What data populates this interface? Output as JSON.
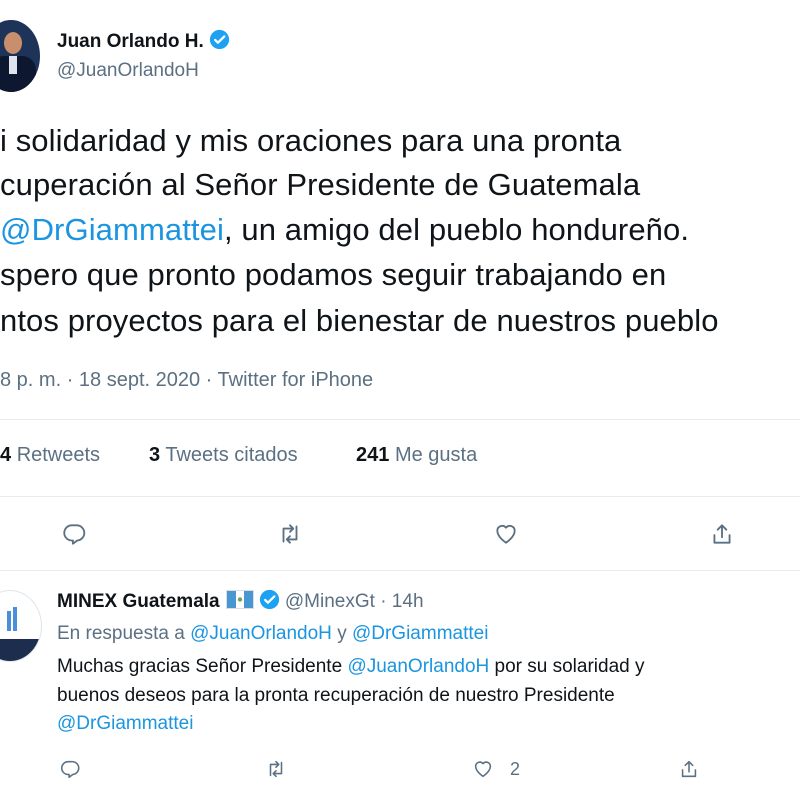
{
  "main_tweet": {
    "author_name": "Juan Orlando H.",
    "author_handle": "@JuanOrlandoH",
    "text_lines": [
      [
        "i solidaridad y mis oraciones para una pronta",
        ""
      ],
      [
        "cuperación al Señor Presidente de Guatemala",
        ""
      ],
      [
        "@DrGiammattei",
        ", un amigo del pueblo hondureño."
      ],
      [
        "spero que pronto podamos seguir trabajando en",
        ""
      ],
      [
        "ntos proyectos para el bienestar de nuestros pueblo",
        ""
      ]
    ],
    "meta": "8 p. m. · 18 sept. 2020 · Twitter for iPhone",
    "stats": {
      "retweets_count": "4",
      "retweets_label": "Retweets",
      "quotes_count": "3",
      "quotes_label": "Tweets citados",
      "likes_count": "241",
      "likes_label": "Me gusta"
    },
    "actions": [
      "reply-icon",
      "retweet-icon",
      "like-icon",
      "share-icon"
    ]
  },
  "reply_tweet": {
    "author_name": "MINEX Guatemala",
    "author_handle": "@MinexGt",
    "time": "· 14h",
    "in_reply_prefix": "En respuesta a",
    "in_reply_user1": "@JuanOrlandoH",
    "in_reply_and": "y",
    "in_reply_user2": "@DrGiammattei",
    "line1_a": "Muchas gracias Señor Presidente",
    "line1_mention": "@JuanOrlandoH",
    "line1_b": "por su solaridad y",
    "line2": "buenos deseos para la pronta recuperación de nuestro Presidente",
    "line3_mention": "@DrGiammattei",
    "like_count": "2"
  },
  "colors": {
    "accent": "#1b95e0",
    "muted": "#5b7083",
    "text": "#0f1419",
    "verified": "#1da1f2"
  }
}
